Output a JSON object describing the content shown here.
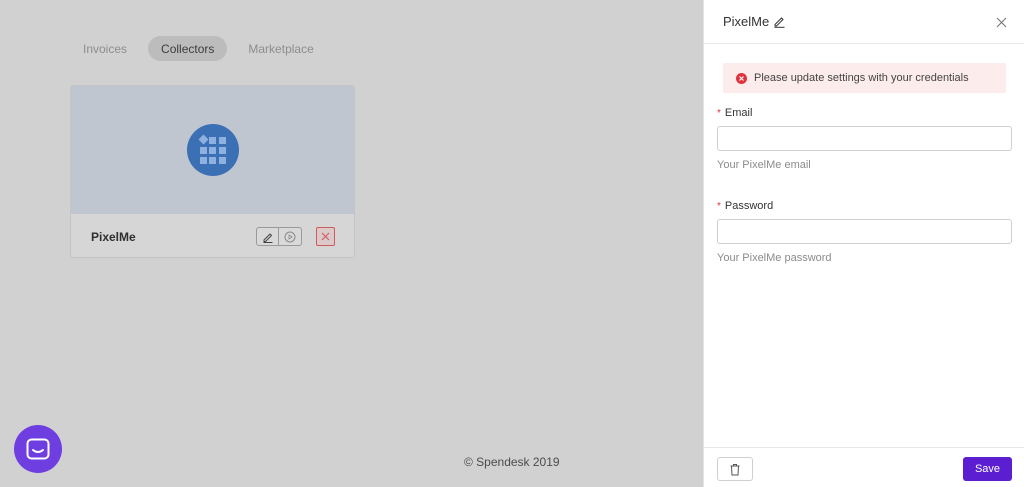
{
  "tabs": [
    {
      "label": "Invoices",
      "active": false
    },
    {
      "label": "Collectors",
      "active": true
    },
    {
      "label": "Marketplace",
      "active": false
    }
  ],
  "collector_card": {
    "name": "PixelMe",
    "logo_icon": "grid-logo-icon",
    "logo_color": "#3c70b4"
  },
  "footer": {
    "copyright": "© Spendesk 2019"
  },
  "panel": {
    "title": "PixelMe",
    "alert": {
      "text": "Please update settings with your credentials",
      "color": "#e0323c"
    },
    "email": {
      "label": "Email",
      "required_mark": "*",
      "value": "",
      "placeholder": "",
      "hint": "Your PixelMe email"
    },
    "password": {
      "label": "Password",
      "required_mark": "*",
      "value": "",
      "placeholder": "",
      "hint": "Your PixelMe password"
    },
    "save_label": "Save",
    "save_color": "#5b1fd1"
  }
}
